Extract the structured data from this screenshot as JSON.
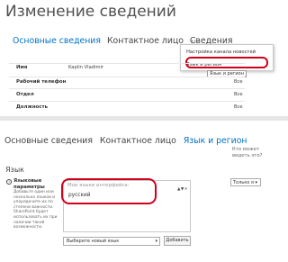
{
  "header": {
    "title": "Изменение сведений"
  },
  "tabs_top": {
    "items": [
      "Основные сведения",
      "Контактное лицо",
      "Сведения"
    ],
    "more": "..."
  },
  "dropdown": {
    "items": [
      "Настройка канала новостей",
      "Язык и регион"
    ],
    "tooltip": "Язык и регион"
  },
  "rows": [
    {
      "label": "Имя",
      "value": "Kaplin Vladimir",
      "visibility": ""
    },
    {
      "label": "Рабочий телефон",
      "value": "",
      "visibility": "Все"
    },
    {
      "label": "Отдел",
      "value": "",
      "visibility": "Все"
    },
    {
      "label": "Должность",
      "value": "",
      "visibility": "Все"
    }
  ],
  "tabs_bottom": {
    "items": [
      "Основные сведения",
      "Контактное лицо",
      "Язык и регион"
    ],
    "who_can_see": "Кто может видеть это?"
  },
  "language_section": {
    "title": "Язык",
    "label": "Языковые параметры",
    "description": "Добавьте один или несколько языков и упорядочите их по степени важности. SharePoint будет использовать их при наличии такой возможности.",
    "box_title": "Мои языки интерфейса:",
    "arrows": "▲▼✕",
    "languages": [
      "русский"
    ],
    "visibility": "Только я",
    "new_language_placeholder": "Выберите новый язык",
    "add_button": "Добавить"
  }
}
